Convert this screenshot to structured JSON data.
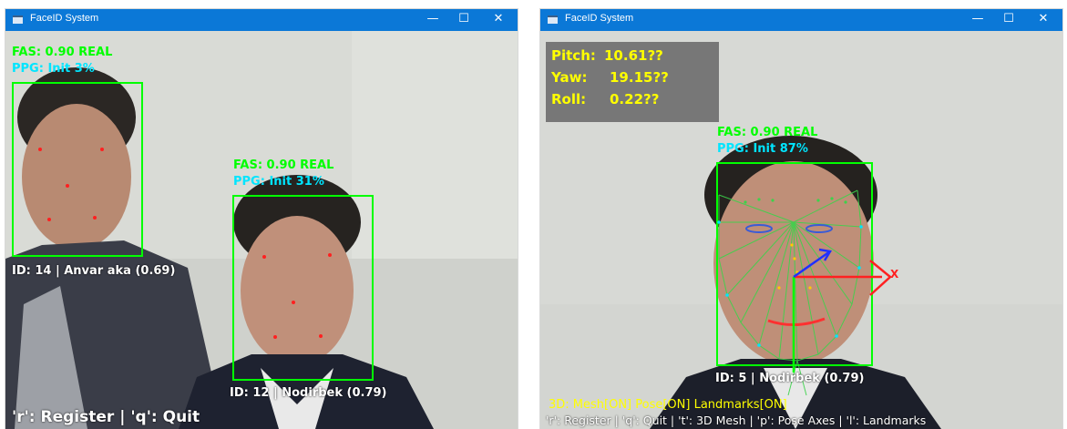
{
  "left_window": {
    "title": "FaceID System",
    "controls": {
      "minimize": "—",
      "maximize": "☐",
      "close": "✕"
    },
    "faces": [
      {
        "fas": "FAS: 0.90 REAL",
        "ppg": "PPG: Init 3%",
        "id_label": "ID: 14 | Anvar aka (0.69)"
      },
      {
        "fas": "FAS: 0.90 REAL",
        "ppg": "PPG: Init 31%",
        "id_label": "ID: 12 | Nodirbek (0.79)"
      }
    ],
    "hint": "'r': Register | 'q': Quit"
  },
  "right_window": {
    "title": "FaceID System",
    "controls": {
      "minimize": "—",
      "maximize": "☐",
      "close": "✕"
    },
    "pose": {
      "pitch_label": "Pitch:",
      "pitch": "10.61??",
      "yaw_label": "Yaw:",
      "yaw": "19.15??",
      "roll_label": "Roll:",
      "roll": "0.22??"
    },
    "face": {
      "fas": "FAS: 0.90 REAL",
      "ppg": "PPG: Init 87%",
      "id_label": "ID: 5 | Nodirbek (0.79)"
    },
    "axis_x_label": "X",
    "status": "3D: Mesh[ON] Pose[ON] Landmarks[ON]",
    "hint": "'r': Register | 'q': Quit | 't': 3D Mesh | 'p': Pose Axes | 'l': Landmarks"
  },
  "colors": {
    "titlebar": "#0b78d7",
    "box": "#00ff00",
    "ppg": "#00e5ff",
    "pose_text": "#ffff00",
    "status": "#ffff00"
  }
}
